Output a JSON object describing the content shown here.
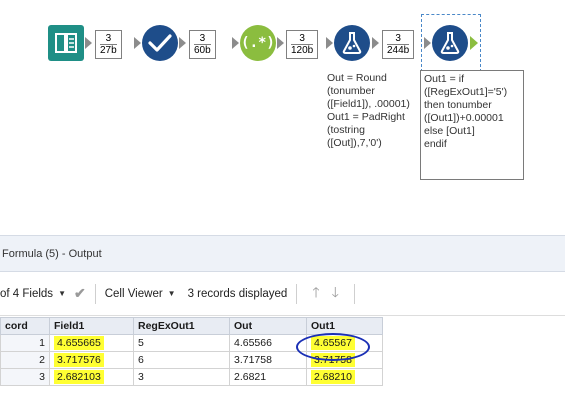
{
  "workflow": {
    "tools": [
      {
        "name": "input-data",
        "icon": "book-icon"
      },
      {
        "name": "select",
        "icon": "checkmark-icon"
      },
      {
        "name": "regex",
        "icon": "regex-icon",
        "label": "(.*)"
      },
      {
        "name": "formula",
        "icon": "flask-icon"
      },
      {
        "name": "formula-5",
        "icon": "flask-icon"
      }
    ],
    "connections": [
      {
        "records": "3",
        "size": "27b"
      },
      {
        "records": "3",
        "size": "60b"
      },
      {
        "records": "3",
        "size": "120b"
      },
      {
        "records": "3",
        "size": "244b"
      }
    ],
    "annotations": {
      "formula": "Out = Round\n(tonumber\n([Field1]), .00001)\nOut1 = PadRight\n(tostring\n([Out]),7,'0')",
      "formula5": "Out1 = if\n([RegExOut1]='5')\nthen tonumber\n([Out1])+0.00001\nelse [Out1]\nendif"
    }
  },
  "panel": {
    "title": "Formula (5) - Output",
    "fields_selector": "of 4 Fields",
    "cell_viewer": "Cell Viewer",
    "records_status": "3 records displayed"
  },
  "table": {
    "headers": [
      "cord",
      "Field1",
      "RegExOut1",
      "Out",
      "Out1"
    ],
    "rows": [
      [
        "1",
        "4.655665",
        "5",
        "4.65566",
        "4.65567"
      ],
      [
        "2",
        "3.717576",
        "6",
        "3.71758",
        "3.71758"
      ],
      [
        "3",
        "2.682103",
        "3",
        "2.6821",
        "2.68210"
      ]
    ]
  },
  "colors": {
    "highlight": "#ffff33",
    "circle": "#1a2fb5",
    "tool_blue": "#1e4d8a",
    "tool_green": "#8bbd3f",
    "tool_teal": "#1f8f86"
  }
}
